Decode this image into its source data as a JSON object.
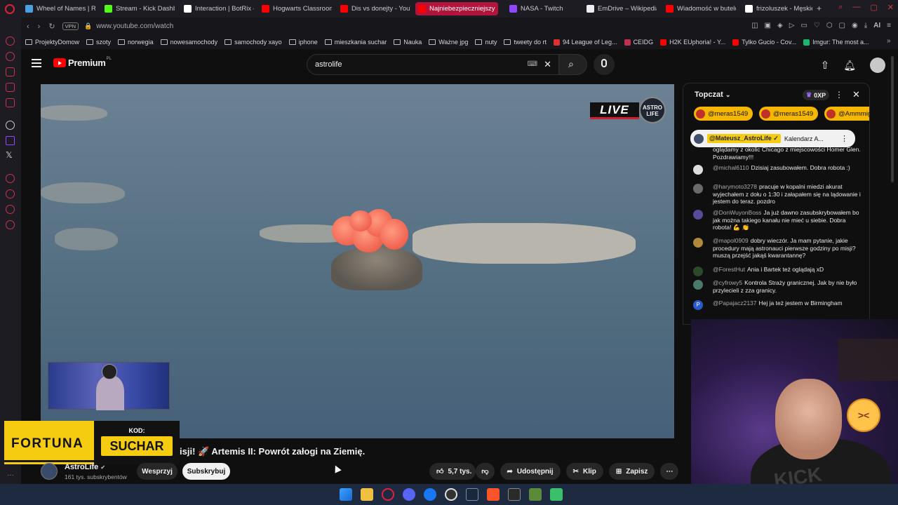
{
  "browser": {
    "tabs": [
      {
        "label": "Wheel of Names | Ran",
        "color": "#4aa0e0"
      },
      {
        "label": "Stream - Kick Dashbo",
        "color": "#53fc18"
      },
      {
        "label": "Interaction | BotRix —",
        "color": "#ffffff"
      },
      {
        "label": "Hogwarts Classroom",
        "color": "#ff0000"
      },
      {
        "label": "Dis vs donejty - YouT",
        "color": "#ff0000"
      },
      {
        "label": "Najniebezpieczniejszy",
        "color": "#ff0000",
        "active": true
      },
      {
        "label": "NASA - Twitch",
        "color": "#9146ff"
      },
      {
        "label": "EmDrive – Wikipedia,",
        "color": "#eeeeee"
      },
      {
        "label": "Wiadomość w butelce",
        "color": "#ff0000"
      },
      {
        "label": "frizoluszek - Męskie, l",
        "color": "#ffffff"
      }
    ],
    "vpn_label": "VPN",
    "url": "www.youtube.com/watch",
    "ai_label": "AI",
    "bookmarks": [
      {
        "label": "ProjektyDomow",
        "type": "folder"
      },
      {
        "label": "szoty",
        "type": "folder"
      },
      {
        "label": "norwegia",
        "type": "folder"
      },
      {
        "label": "nowesamochody",
        "type": "folder"
      },
      {
        "label": "samochody xayo",
        "type": "folder"
      },
      {
        "label": "iphone",
        "type": "folder"
      },
      {
        "label": "mieszkania suchar",
        "type": "folder"
      },
      {
        "label": "Nauka",
        "type": "folder"
      },
      {
        "label": "Ważne jpg",
        "type": "folder"
      },
      {
        "label": "nuty",
        "type": "folder"
      },
      {
        "label": "tweety do rt",
        "type": "folder"
      },
      {
        "label": "94 League of Leg...",
        "type": "site",
        "color": "#e03030"
      },
      {
        "label": "CEIDG",
        "type": "site",
        "color": "#c03050"
      },
      {
        "label": "H2K EUphoria! - Y...",
        "type": "site",
        "color": "#ff0000"
      },
      {
        "label": "Tylko Gucio - Cov...",
        "type": "site",
        "color": "#ff0000"
      },
      {
        "label": "Imgur: The most a...",
        "type": "site",
        "color": "#1bb76e"
      }
    ]
  },
  "youtube": {
    "logo_text": "Premium",
    "logo_region": "PL",
    "search_value": "astrolife",
    "video": {
      "live_label": "LIVE",
      "badge_line1": "ASTRO",
      "badge_line2": "LIFE",
      "title": "isji! 🚀 Artemis II: Powrót załogi na Ziemię."
    },
    "promo": {
      "brand": "FORTUNA",
      "code_label": "KOD:",
      "code": "SUCHAR"
    },
    "channel": {
      "name": "AstroLife",
      "subscribers": "161 tys. subskrybentów",
      "support_label": "Wesprzyj",
      "subscribe_label": "Subskrybuj"
    },
    "actions": {
      "likes": "5,7 tys.",
      "share": "Udostępnij",
      "clip": "Klip",
      "save": "Zapisz"
    }
  },
  "chat": {
    "title": "Topczat",
    "xp": "0XP",
    "tickers": [
      "@meras1549",
      "@meras1549",
      "@Ammmig"
    ],
    "pinned": {
      "user": "@Mateusz_AstroLife ✓",
      "text": "Kalendarz A..."
    },
    "messages": [
      {
        "user": "",
        "text": "oglądamy z okolic Chicago z miejscowości Homer Glen. Pozdrawiamy!!!",
        "avatar": "#555555"
      },
      {
        "user": "@michal6110",
        "text": "Dzisiaj zasubowałem. Dobra robota :)",
        "avatar": "#dddddd"
      },
      {
        "user": "@harymoto3278",
        "text": "pracuje w kopalni miedzi akurat wyjechałem z dołu o 1:30 i załapałem się na lądowanie i jestem do teraz. pozdro",
        "avatar": "#6a6a6a"
      },
      {
        "user": "@DonWuyonBoss",
        "text": "Ja już dawno zasubskrybowałem bo jak można takiego kanału nie mieć u siebie. Dobra robota! 💪 👏",
        "avatar": "#5a4a9a"
      },
      {
        "user": "@mapol0909",
        "text": "dobry wieczór. Ja mam pytanie, jakie procedury mają astronauci pierwsze godziny po misji? muszą przejść jakąś kwarantannę?",
        "avatar": "#b08a3a"
      },
      {
        "user": "@ForestHut",
        "text": "Ania i Bartek też oglądają xD",
        "avatar": "#2a4a2a"
      },
      {
        "user": "@cyfrowy5",
        "text": "Kontrola Straży granicznej. Jak by nie było przylecieli z zza granicy.",
        "avatar": "#4a7a6a"
      },
      {
        "user": "@Papajacz2137",
        "text": "Hej ja też jestem w Birmingham",
        "avatar": "#2a5ad0",
        "initial": "P"
      }
    ]
  },
  "webcam": {
    "shirt_text": "KICK"
  }
}
